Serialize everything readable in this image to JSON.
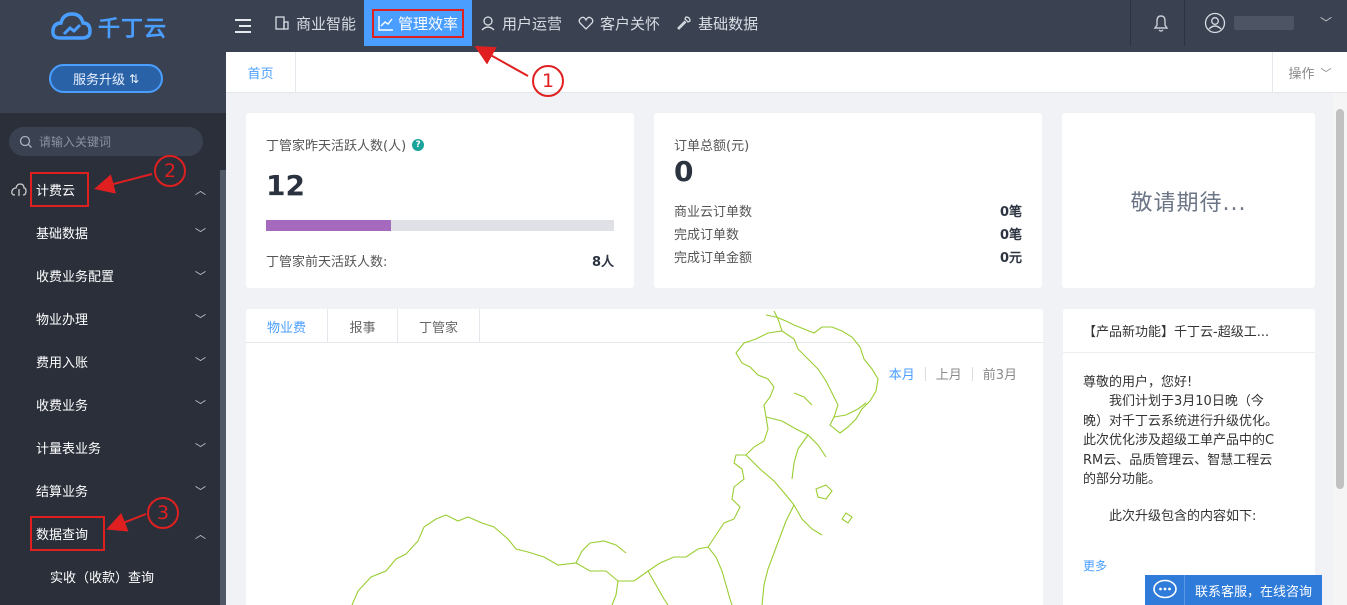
{
  "sidebar": {
    "logo_text": "千丁云",
    "upgrade_label": "服务升级",
    "search_placeholder": "请输入关键词",
    "menu": [
      {
        "label": "计费云",
        "level": "top"
      },
      {
        "label": "基础数据",
        "level": "sub"
      },
      {
        "label": "收费业务配置",
        "level": "sub"
      },
      {
        "label": "物业办理",
        "level": "sub"
      },
      {
        "label": "费用入账",
        "level": "sub"
      },
      {
        "label": "收费业务",
        "level": "sub"
      },
      {
        "label": "计量表业务",
        "level": "sub"
      },
      {
        "label": "结算业务",
        "level": "sub"
      },
      {
        "label": "数据查询",
        "level": "sub"
      },
      {
        "label": "实收（收款）查询",
        "level": "leaf"
      }
    ]
  },
  "topnav": {
    "items": [
      {
        "label": "商业智能",
        "icon": "building-icon",
        "active": false
      },
      {
        "label": "管理效率",
        "icon": "chart-line-icon",
        "active": true
      },
      {
        "label": "用户运营",
        "icon": "user-ops-icon",
        "active": false
      },
      {
        "label": "客户关怀",
        "icon": "heart-icon",
        "active": false
      },
      {
        "label": "基础数据",
        "icon": "wrench-icon",
        "active": false
      }
    ]
  },
  "tabbar": {
    "home_label": "首页",
    "ops_label": "操作"
  },
  "kpi1": {
    "label": "丁管家昨天活跃人数(人)",
    "value": "12",
    "progress_fraction": 0.36,
    "footer_label": "丁管家前天活跃人数:",
    "footer_value": "8人"
  },
  "kpi2": {
    "label": "订单总额(元)",
    "value": "0",
    "rows": [
      {
        "label": "商业云订单数",
        "value": "0笔"
      },
      {
        "label": "完成订单数",
        "value": "0笔"
      },
      {
        "label": "完成订单金额",
        "value": "0元"
      }
    ]
  },
  "kpi3": {
    "label": "敬请期待..."
  },
  "map_panel": {
    "tabs": [
      "物业费",
      "报事",
      "丁管家"
    ],
    "ranges": [
      "本月",
      "上月",
      "前3月"
    ]
  },
  "notice": {
    "title": "【产品新功能】千丁云-超级工...",
    "body_lines": [
      "尊敬的用户，您好!",
      "　　我们计划于3月10日晚（今晚）对千丁云系统进行升级优化。此次优化涉及超级工单产品中的CRM云、品质管理云、智慧工程云的部分功能。",
      "",
      "　　此次升级包含的内容如下:"
    ],
    "more_label": "更多"
  },
  "chat": {
    "label": "联系客服，在线咨询"
  },
  "annotations": [
    "1",
    "2",
    "3"
  ],
  "colors": {
    "accent": "#4a9eff",
    "annotation": "#e02020",
    "progress": "#a569bd",
    "sidebar_bg": "#2a2f3a",
    "topbar_bg": "#3a4151"
  }
}
